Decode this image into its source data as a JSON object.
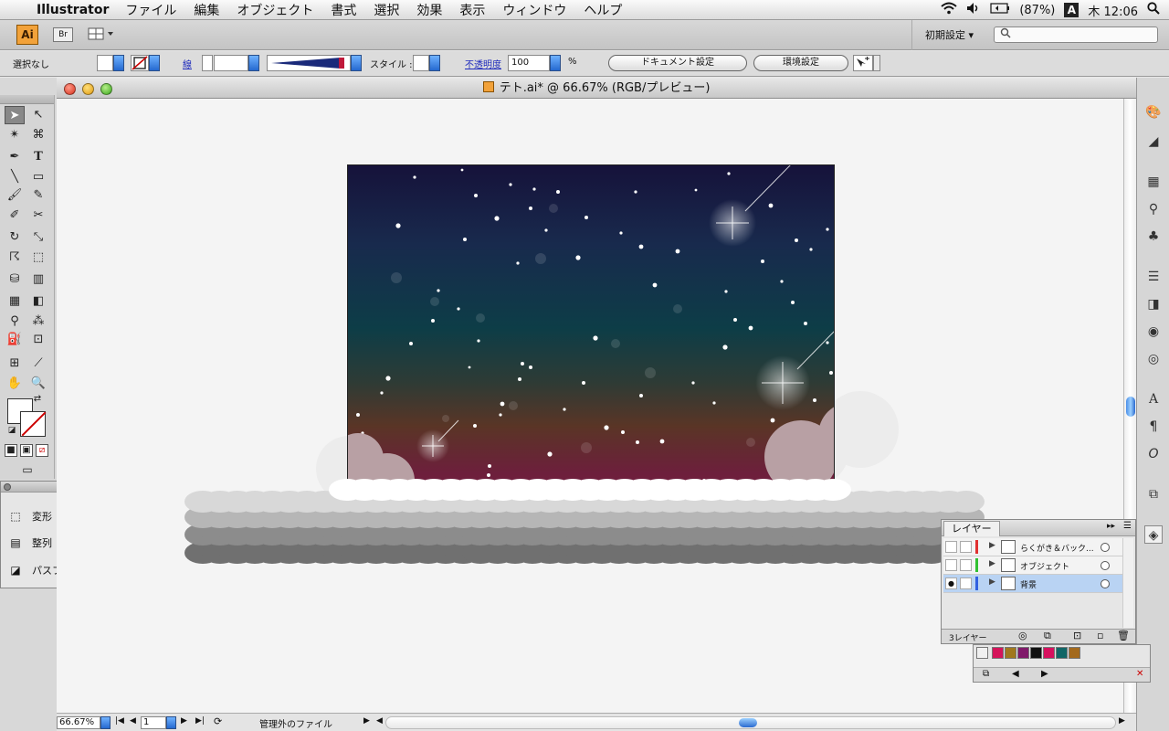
{
  "menubar": {
    "app": "Illustrator",
    "items": [
      "ファイル",
      "編集",
      "オブジェクト",
      "書式",
      "選択",
      "効果",
      "表示",
      "ウィンドウ",
      "ヘルプ"
    ],
    "battery": "(87%)",
    "input_method": "A",
    "clock": "木 12:06"
  },
  "appbar": {
    "logo": "Ai",
    "bridge": "Br",
    "workspace": "初期設定 ▾"
  },
  "control": {
    "selection": "選択なし",
    "stroke_label": "線",
    "style_label": "スタイル :",
    "opacity_label": "不透明度",
    "opacity_value": "100",
    "percent": "%",
    "doc_settings": "ドキュメント設定",
    "preferences": "環境設定"
  },
  "document": {
    "title": "テト.ai* @ 66.67% (RGB/プレビュー)",
    "zoom": "66.67%",
    "page": "1",
    "status": "管理外のファイル"
  },
  "panels": {
    "transform": "変形",
    "align": "整列",
    "pathfinder": "パスファインダ"
  },
  "layers": {
    "tab": "レイヤー",
    "rows": [
      {
        "name": "らくがき＆バック...",
        "color": "#e03030",
        "selected": false,
        "visible": false
      },
      {
        "name": "オブジェクト",
        "color": "#30c030",
        "selected": false,
        "visible": false
      },
      {
        "name": "背景",
        "color": "#3060e0",
        "selected": true,
        "visible": true
      }
    ],
    "count": "3レイヤー"
  },
  "swatch_colors": [
    "#d4145a",
    "#a0781e",
    "#801a6a",
    "#111111",
    "#d6105e",
    "#116666",
    "#a36a1e"
  ]
}
